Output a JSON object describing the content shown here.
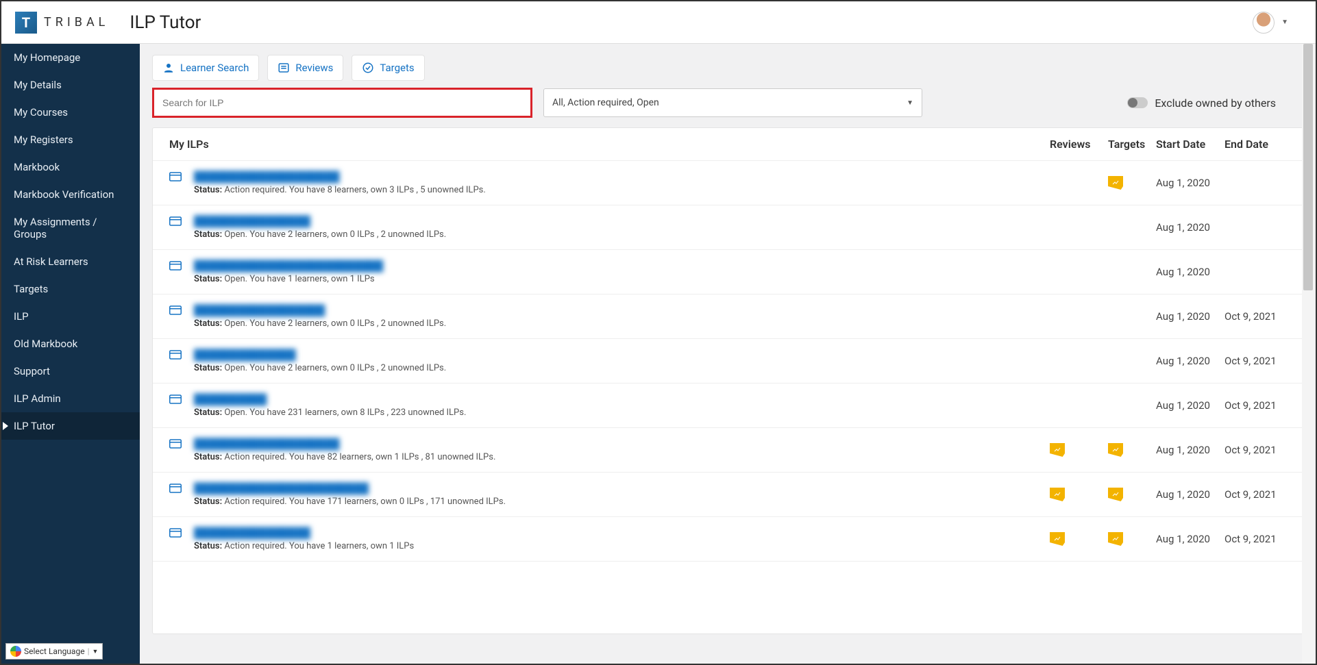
{
  "brand": "TRIBAL",
  "page_title": "ILP Tutor",
  "sidebar": {
    "items": [
      {
        "label": "My Homepage"
      },
      {
        "label": "My Details"
      },
      {
        "label": "My Courses"
      },
      {
        "label": "My Registers"
      },
      {
        "label": "Markbook"
      },
      {
        "label": "Markbook Verification"
      },
      {
        "label": "My Assignments / Groups"
      },
      {
        "label": "At Risk Learners"
      },
      {
        "label": "Targets"
      },
      {
        "label": "ILP"
      },
      {
        "label": "Old Markbook"
      },
      {
        "label": "Support"
      },
      {
        "label": "ILP Admin"
      },
      {
        "label": "ILP Tutor"
      }
    ],
    "active_index": 13
  },
  "actions": {
    "learner_search": "Learner Search",
    "reviews": "Reviews",
    "targets": "Targets"
  },
  "search": {
    "placeholder": "Search for ILP"
  },
  "status_filter": {
    "value": "All, Action required, Open"
  },
  "exclude_toggle": {
    "label": "Exclude owned by others",
    "value": false
  },
  "table": {
    "title": "My ILPs",
    "cols": {
      "reviews": "Reviews",
      "targets": "Targets",
      "start": "Start Date",
      "end": "End Date"
    },
    "rows": [
      {
        "link": "████████████████████",
        "status_label": "Status:",
        "status": "Action required. You have 8 learners, own 3 ILPs , 5 unowned ILPs.",
        "rev": false,
        "tgt": true,
        "start": "Aug 1, 2020",
        "end": ""
      },
      {
        "link": "████████████████",
        "status_label": "Status:",
        "status": "Open. You have 2 learners, own 0 ILPs , 2 unowned ILPs.",
        "rev": false,
        "tgt": false,
        "start": "Aug 1, 2020",
        "end": ""
      },
      {
        "link": "██████████████████████████",
        "status_label": "Status:",
        "status": "Open. You have 1 learners, own 1 ILPs",
        "rev": false,
        "tgt": false,
        "start": "Aug 1, 2020",
        "end": ""
      },
      {
        "link": "██████████████████",
        "status_label": "Status:",
        "status": "Open. You have 2 learners, own 0 ILPs , 2 unowned ILPs.",
        "rev": false,
        "tgt": false,
        "start": "Aug 1, 2020",
        "end": "Oct 9, 2021"
      },
      {
        "link": "██████████████",
        "status_label": "Status:",
        "status": "Open. You have 2 learners, own 0 ILPs , 2 unowned ILPs.",
        "rev": false,
        "tgt": false,
        "start": "Aug 1, 2020",
        "end": "Oct 9, 2021"
      },
      {
        "link": "██████████",
        "status_label": "Status:",
        "status": "Open. You have 231 learners, own 8 ILPs , 223 unowned ILPs.",
        "rev": false,
        "tgt": false,
        "start": "Aug 1, 2020",
        "end": "Oct 9, 2021"
      },
      {
        "link": "████████████████████",
        "status_label": "Status:",
        "status": "Action required. You have 82 learners, own 1 ILPs , 81 unowned ILPs.",
        "rev": true,
        "tgt": true,
        "start": "Aug 1, 2020",
        "end": "Oct 9, 2021"
      },
      {
        "link": "████████████████████████",
        "status_label": "Status:",
        "status": "Action required. You have 171 learners, own 0 ILPs , 171 unowned ILPs.",
        "rev": true,
        "tgt": true,
        "start": "Aug 1, 2020",
        "end": "Oct 9, 2021"
      },
      {
        "link": "████████████████",
        "status_label": "Status:",
        "status": "Action required. You have 1 learners, own 1 ILPs",
        "rev": true,
        "tgt": true,
        "start": "Aug 1, 2020",
        "end": "Oct 9, 2021"
      }
    ]
  },
  "lang": {
    "label": "Select Language"
  }
}
